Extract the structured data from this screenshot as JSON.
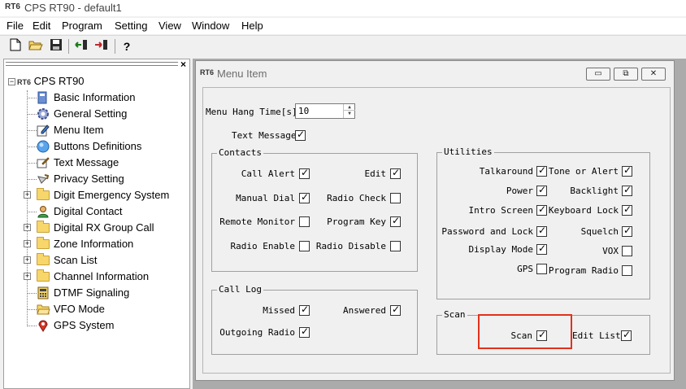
{
  "app": {
    "logo_text": "RT6",
    "title": "CPS RT90 - default1"
  },
  "menubar": [
    "File",
    "Edit",
    "Program",
    "Setting",
    "View",
    "Window",
    "Help"
  ],
  "toolbar": {
    "buttons": [
      "new-file-icon",
      "open-folder-icon",
      "save-disk-icon",
      "read-from-radio-icon",
      "write-to-radio-icon",
      "help-icon"
    ]
  },
  "tree": {
    "close_label": "×",
    "root": {
      "label": "CPS RT90",
      "logo": "RT6"
    },
    "items": [
      {
        "label": "Basic Information",
        "icon": "book-icon",
        "expandable": false
      },
      {
        "label": "General Setting",
        "icon": "gear-icon",
        "expandable": false
      },
      {
        "label": "Menu Item",
        "icon": "edit-note-icon",
        "expandable": false
      },
      {
        "label": "Buttons Definitions",
        "icon": "circle-button-icon",
        "expandable": false
      },
      {
        "label": "Text Message",
        "icon": "message-icon",
        "expandable": false
      },
      {
        "label": "Privacy Setting",
        "icon": "key-icon",
        "expandable": false
      },
      {
        "label": "Digit Emergency System",
        "icon": "folder-icon",
        "expandable": true
      },
      {
        "label": "Digital Contact",
        "icon": "contact-icon",
        "expandable": false
      },
      {
        "label": "Digital RX Group Call",
        "icon": "folder-icon",
        "expandable": true
      },
      {
        "label": "Zone Information",
        "icon": "folder-icon",
        "expandable": true
      },
      {
        "label": "Scan List",
        "icon": "folder-icon",
        "expandable": true
      },
      {
        "label": "Channel Information",
        "icon": "folder-icon",
        "expandable": true
      },
      {
        "label": "DTMF Signaling",
        "icon": "keypad-icon",
        "expandable": false
      },
      {
        "label": "VFO Mode",
        "icon": "folder-open-icon",
        "expandable": false
      },
      {
        "label": "GPS System",
        "icon": "map-pin-icon",
        "expandable": false
      }
    ]
  },
  "window": {
    "logo_text": "RT6",
    "title": "Menu Item",
    "minimize": "▭",
    "restore": "⧉",
    "close": "✕"
  },
  "form": {
    "hang_time": {
      "label": "Menu Hang Time[s]",
      "value": "10"
    },
    "text_message": {
      "label": "Text Message",
      "checked": true
    },
    "contacts": {
      "title": "Contacts",
      "items": [
        {
          "label": "Call Alert",
          "checked": true
        },
        {
          "label": "Edit",
          "checked": true
        },
        {
          "label": "Manual Dial",
          "checked": true
        },
        {
          "label": "Radio Check",
          "checked": false
        },
        {
          "label": "Remote Monitor",
          "checked": false
        },
        {
          "label": "Program Key",
          "checked": true
        },
        {
          "label": "Radio Enable",
          "checked": false
        },
        {
          "label": "Radio Disable",
          "checked": false
        }
      ]
    },
    "utilities": {
      "title": "Utilities",
      "items": [
        {
          "label": "Talkaround",
          "checked": true
        },
        {
          "label": "Tone or Alert",
          "checked": true
        },
        {
          "label": "Power",
          "checked": true
        },
        {
          "label": "Backlight",
          "checked": true
        },
        {
          "label": "Intro Screen",
          "checked": true
        },
        {
          "label": "Keyboard Lock",
          "checked": true
        },
        {
          "label": "Password and Lock",
          "checked": true
        },
        {
          "label": "Squelch",
          "checked": true
        },
        {
          "label": "Display Mode",
          "checked": true
        },
        {
          "label": "VOX",
          "checked": false
        },
        {
          "label": "GPS",
          "checked": false
        },
        {
          "label": "Program Radio",
          "checked": false
        }
      ]
    },
    "call_log": {
      "title": "Call Log",
      "items": [
        {
          "label": "Missed",
          "checked": true
        },
        {
          "label": "Answered",
          "checked": true
        },
        {
          "label": "Outgoing Radio",
          "checked": true
        }
      ]
    },
    "scan": {
      "title": "Scan",
      "items": [
        {
          "label": "Scan",
          "checked": true
        },
        {
          "label": "Edit List",
          "checked": true
        }
      ]
    }
  },
  "colors": {
    "highlight": "#e2311b",
    "mdi_background": "#ababab"
  }
}
